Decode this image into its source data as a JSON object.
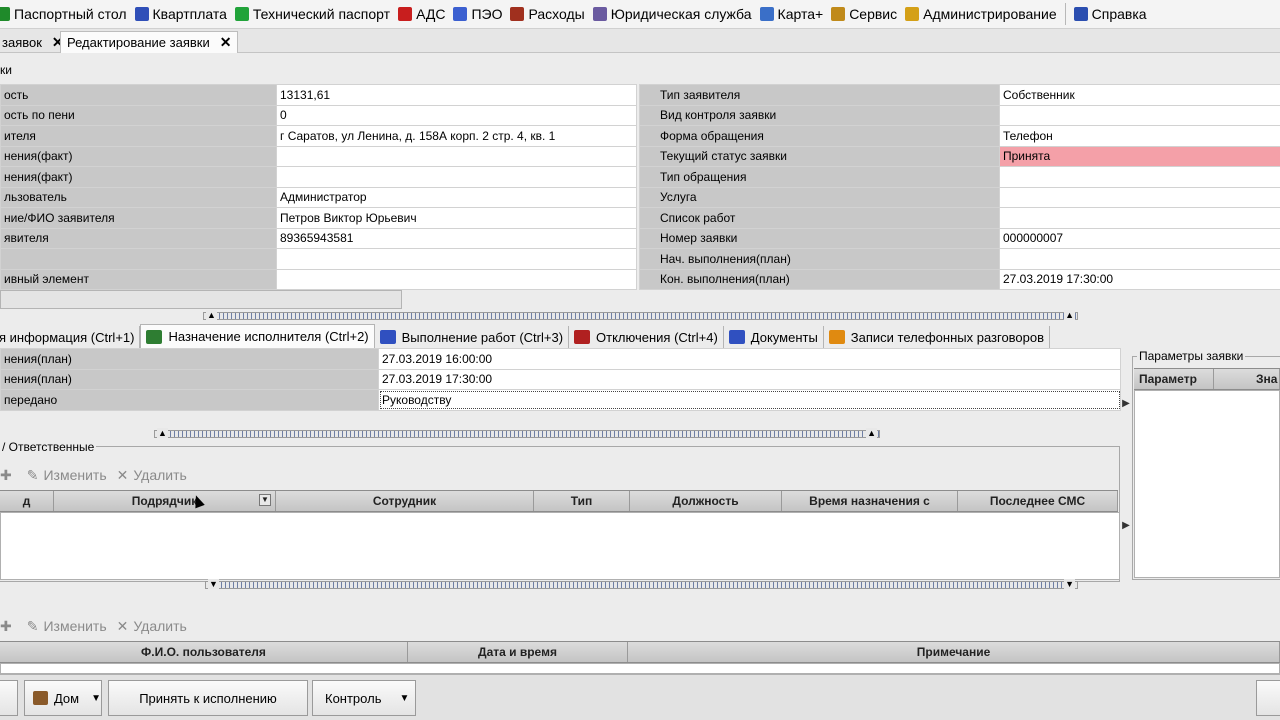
{
  "menubar": {
    "items": [
      {
        "label": "Паспортный стол",
        "icon": "passport-icon",
        "color": "#1f8a2a"
      },
      {
        "label": "Квартплата",
        "icon": "book-icon",
        "color": "#2f4fb8"
      },
      {
        "label": "Технический паспорт",
        "icon": "tech-passport-icon",
        "color": "#21a33a"
      },
      {
        "label": "АДС",
        "icon": "fire-extinguisher-icon",
        "color": "#c81e1e"
      },
      {
        "label": "ПЭО",
        "icon": "chart-icon",
        "color": "#3b5fd0"
      },
      {
        "label": "Расходы",
        "icon": "money-bag-icon",
        "color": "#a0301e"
      },
      {
        "label": "Юридическая служба",
        "icon": "scales-icon",
        "color": "#6a5aa0"
      },
      {
        "label": "Карта+",
        "icon": "map-icon",
        "color": "#3a6fc8"
      },
      {
        "label": "Сервис",
        "icon": "service-icon",
        "color": "#c08a1a"
      },
      {
        "label": "Администрирование",
        "icon": "key-icon",
        "color": "#d4a017"
      },
      {
        "label": "Справка",
        "icon": "help-icon",
        "color": "#2b4eb0"
      }
    ]
  },
  "doctabs": {
    "tab1_label": "заявок",
    "tab2_label": "Редактирование заявки",
    "close_glyph": "✕"
  },
  "top_section": {
    "label": "ки"
  },
  "left_grid": [
    {
      "label": "ость",
      "value": "13131,61"
    },
    {
      "label": "ость по пени",
      "value": "0"
    },
    {
      "label": "ителя",
      "value": "г Саратов, ул Ленина, д. 158А корп. 2 стр. 4, кв. 1"
    },
    {
      "label": "нения(факт)",
      "value": ""
    },
    {
      "label": "нения(факт)",
      "value": ""
    },
    {
      "label": "льзователь",
      "value": "Администратор"
    },
    {
      "label": "ние/ФИО заявителя",
      "value": "Петров Виктор Юрьевич"
    },
    {
      "label": "явителя",
      "value": "89365943581"
    },
    {
      "label": "",
      "value": ""
    },
    {
      "label": "ивный элемент",
      "value": ""
    }
  ],
  "right_grid": [
    {
      "label": "Тип заявителя",
      "value": "Собственник"
    },
    {
      "label": "Вид контроля заявки",
      "value": ""
    },
    {
      "label": "Форма обращения",
      "value": "Телефон"
    },
    {
      "label": "Текущий статус заявки",
      "value": "Принята",
      "highlight": "#f4a0a8"
    },
    {
      "label": "Тип обращения",
      "value": ""
    },
    {
      "label": "Услуга",
      "value": ""
    },
    {
      "label": "Список работ",
      "value": ""
    },
    {
      "label": "Номер заявки",
      "value": "000000007"
    },
    {
      "label": "Нач. выполнения(план)",
      "value": ""
    },
    {
      "label": "Кон. выполнения(план)",
      "value": "27.03.2019 17:30:00"
    }
  ],
  "inner_tabs": [
    {
      "label": "я информация (Ctrl+1)",
      "icon": ""
    },
    {
      "label": "Назначение исполнителя (Ctrl+2)",
      "icon": "assign-executor-icon",
      "color": "#2e7d32",
      "active": true
    },
    {
      "label": "Выполнение работ (Ctrl+3)",
      "icon": "wrench-icon",
      "color": "#3050c0"
    },
    {
      "label": "Отключения (Ctrl+4)",
      "icon": "disconnect-icon",
      "color": "#b02020"
    },
    {
      "label": "Документы",
      "icon": "documents-icon",
      "color": "#3050c0"
    },
    {
      "label": "Записи телефонных разговоров",
      "icon": "phone-records-icon",
      "color": "#e08a10"
    }
  ],
  "assign_grid": [
    {
      "label": "нения(план)",
      "value": "27.03.2019 16:00:00"
    },
    {
      "label": "нения(план)",
      "value": "27.03.2019 17:30:00"
    },
    {
      "label": "передано",
      "value": "Руководству"
    }
  ],
  "responsible": {
    "title": "/ Ответственные",
    "edit_label": "Изменить",
    "delete_label": "Удалить",
    "columns": [
      "д",
      "Подрядчик",
      "Сотрудник",
      "Тип",
      "Должность",
      "Время назначения с",
      "Последнее СМС"
    ]
  },
  "params": {
    "title": "Параметры заявки",
    "columns": [
      "Параметр",
      "Зна"
    ]
  },
  "history": {
    "edit_label": "Изменить",
    "delete_label": "Удалить",
    "columns": [
      "Ф.И.О. пользователя",
      "Дата и время",
      "Примечание"
    ]
  },
  "bottom_bar": {
    "btn_house": "Дом",
    "btn_accept": "Принять к исполнению",
    "btn_control": "Контроль"
  }
}
